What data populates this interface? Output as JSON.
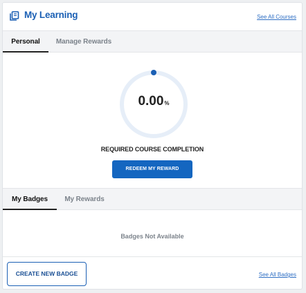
{
  "header": {
    "title": "My Learning",
    "icon": "learning-icon",
    "see_all_courses": "See All Courses"
  },
  "top_tabs": [
    {
      "label": "Personal",
      "active": true
    },
    {
      "label": "Manage Rewards",
      "active": false
    }
  ],
  "progress": {
    "value": "0.00",
    "unit": "%",
    "fraction": 0,
    "label": "REQUIRED COURSE COMPLETION",
    "track_color": "#e6eef8",
    "marker_color": "#1a5fb4"
  },
  "redeem_button": "REDEEM MY REWARD",
  "bottom_tabs": [
    {
      "label": "My Badges",
      "active": true
    },
    {
      "label": "My Rewards",
      "active": false
    }
  ],
  "badges": {
    "empty_text": "Badges Not Available",
    "create_button": "CREATE NEW BADGE",
    "see_all": "See All Badges"
  },
  "colors": {
    "accent": "#1a5fb4",
    "button": "#1466c0"
  }
}
